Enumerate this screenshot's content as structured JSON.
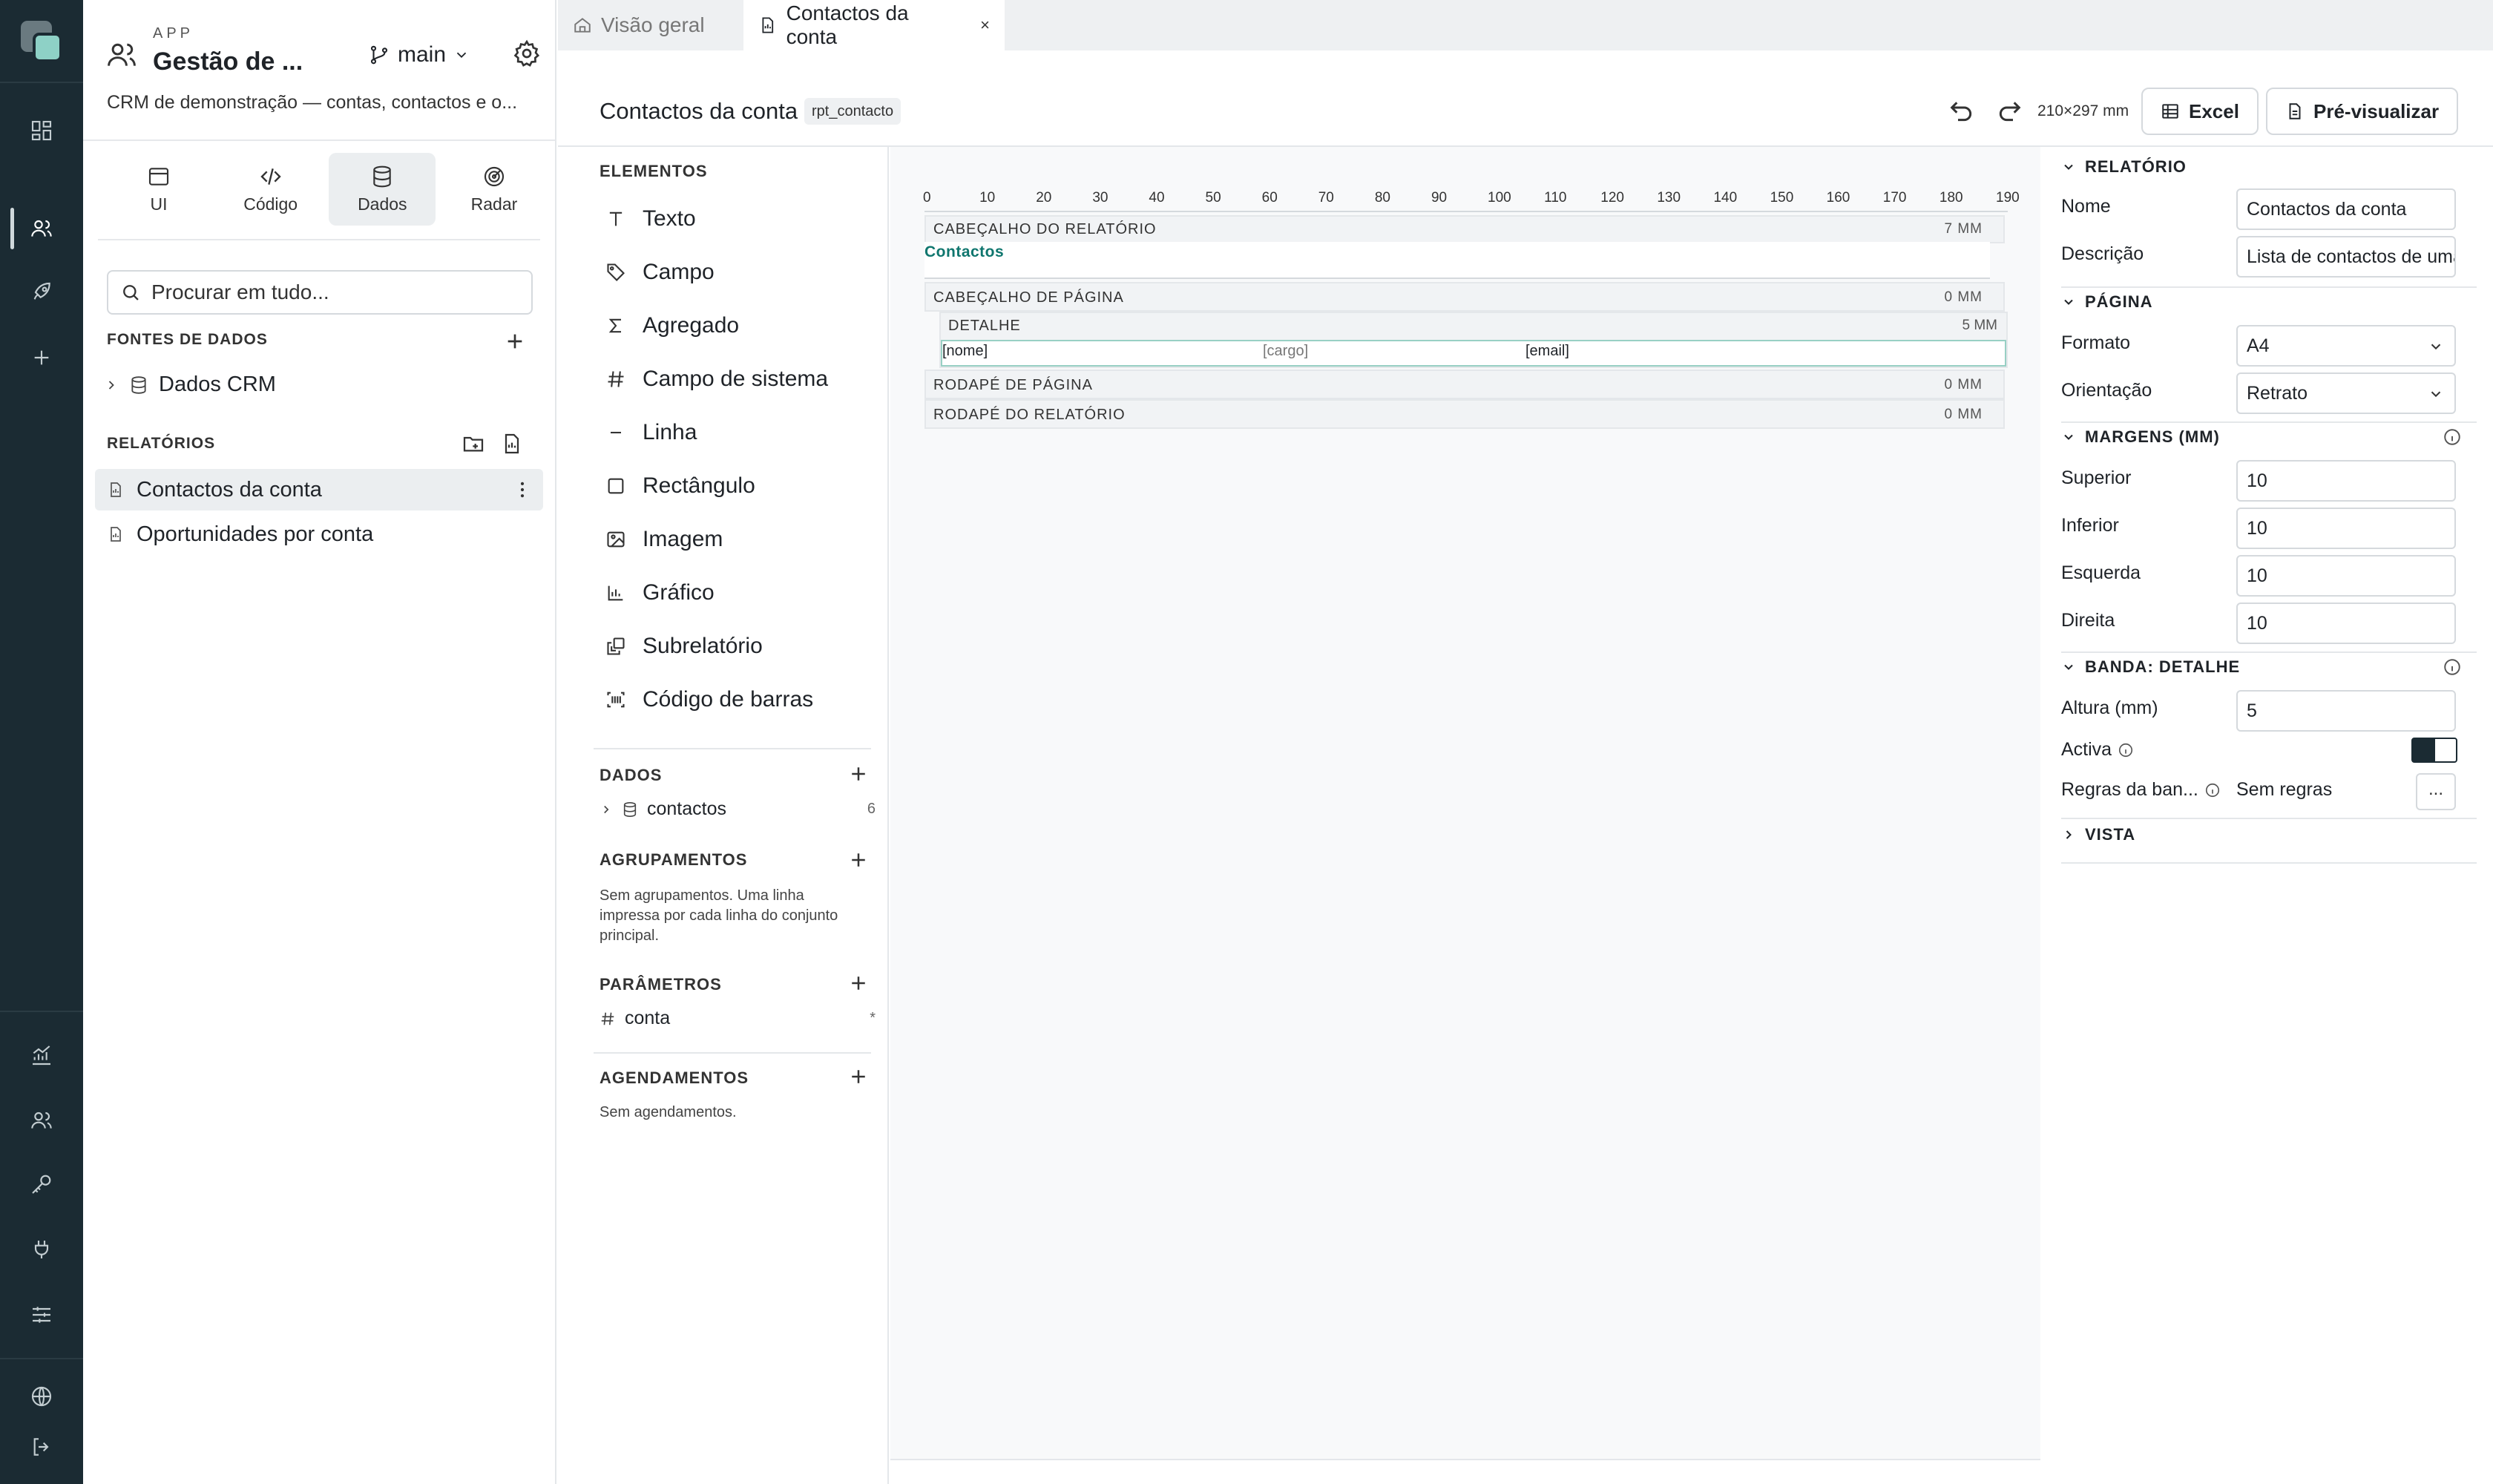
{
  "explorer": {
    "kicker": "APP",
    "app_title": "Gestão de ...",
    "branch": "main",
    "description": "CRM de demonstração — contas, contactos e o...",
    "modes": [
      {
        "label": "UI",
        "icon": "window-icon"
      },
      {
        "label": "Código",
        "icon": "code-icon"
      },
      {
        "label": "Dados",
        "icon": "database-icon",
        "active": true
      },
      {
        "label": "Radar",
        "icon": "radar-icon"
      }
    ],
    "search_placeholder": "Procurar em tudo...",
    "sources_label": "FONTES DE DADOS",
    "sources": [
      {
        "label": "Dados CRM"
      }
    ],
    "reports_label": "RELATÓRIOS",
    "reports": [
      {
        "label": "Contactos da conta",
        "active": true
      },
      {
        "label": "Oportunidades por conta"
      }
    ]
  },
  "tabs": [
    {
      "label": "Visão geral",
      "icon": "home-icon"
    },
    {
      "label": "Contactos da conta",
      "icon": "report-icon",
      "active": true,
      "close": "×"
    }
  ],
  "doc": {
    "title": "Contactos da conta",
    "badge": "rpt_contacto",
    "page_size": "210×297 mm",
    "excel_label": "Excel",
    "preview_label": "Pré-visualizar"
  },
  "palette": {
    "elements_label": "ELEMENTOS",
    "elements": [
      "Texto",
      "Campo",
      "Agregado",
      "Campo de sistema",
      "Linha",
      "Rectângulo",
      "Imagem",
      "Gráfico",
      "Subrelatório",
      "Código de barras"
    ],
    "data_label": "DADOS",
    "data_items": [
      {
        "label": "contactos",
        "count": "6"
      }
    ],
    "groups_label": "AGRUPAMENTOS",
    "groups_note": "Sem agrupamentos. Uma linha impressa por cada linha do conjunto principal.",
    "params_label": "PARÂMETROS",
    "params": [
      {
        "label": "conta",
        "mark": "*"
      }
    ],
    "schedules_label": "AGENDAMENTOS",
    "schedules_note": "Sem agendamentos."
  },
  "canvas": {
    "ruler": [
      "0",
      "10",
      "20",
      "30",
      "40",
      "50",
      "60",
      "70",
      "80",
      "90",
      "100",
      "110",
      "120",
      "130",
      "140",
      "150",
      "160",
      "170",
      "180",
      "190"
    ],
    "report_header": {
      "name": "CABEÇALHO DO RELATÓRIO",
      "height": "7 MM",
      "text": "Contactos"
    },
    "page_header": {
      "name": "CABEÇALHO DE PÁGINA",
      "height": "0 MM"
    },
    "detail": {
      "name": "DETALHE",
      "height": "5 MM",
      "fields": [
        "[nome]",
        "[cargo]",
        "[email]"
      ]
    },
    "page_footer": {
      "name": "RODAPÉ DE PÁGINA",
      "height": "0 MM"
    },
    "report_footer": {
      "name": "RODAPÉ DO RELATÓRIO",
      "height": "0 MM"
    }
  },
  "props": {
    "report_label": "RELATÓRIO",
    "name_label": "Nome",
    "name_value": "Contactos da conta",
    "desc_label": "Descrição",
    "desc_value": "Lista de contactos de uma conta",
    "page_label": "PÁGINA",
    "format_label": "Formato",
    "format_value": "A4",
    "orientation_label": "Orientação",
    "orientation_value": "Retrato",
    "margins_label": "MARGENS (MM)",
    "top_label": "Superior",
    "top_value": "10",
    "bottom_label": "Inferior",
    "bottom_value": "10",
    "left_label": "Esquerda",
    "left_value": "10",
    "right_label": "Direita",
    "right_value": "10",
    "band_label": "BANDA: DETALHE",
    "height_label": "Altura (mm)",
    "height_value": "5",
    "active_label": "Activa",
    "rules_label": "Regras da ban...",
    "rules_value": "Sem regras",
    "rules_button": "...",
    "view_label": "VISTA"
  },
  "colors": {
    "rail": "#1b2b33",
    "accent": "#0f766e",
    "detail_border": "#98d0c4"
  }
}
